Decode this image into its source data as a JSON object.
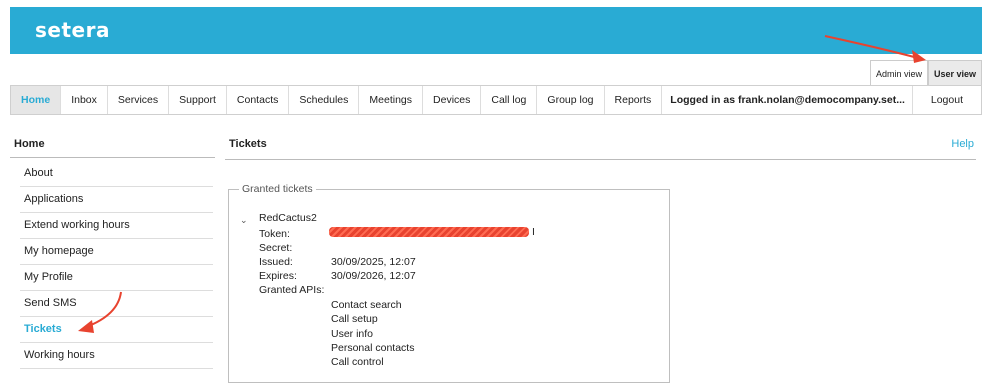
{
  "brand": {
    "logo": "setera"
  },
  "view_switch": {
    "admin": "Admin view",
    "user": "User view"
  },
  "nav": {
    "items": [
      "Home",
      "Inbox",
      "Services",
      "Support",
      "Contacts",
      "Schedules",
      "Meetings",
      "Devices",
      "Call log",
      "Group log",
      "Reports"
    ],
    "login_text": "Logged in as frank.nolan@democompany.set...",
    "logout": "Logout"
  },
  "sidebar": {
    "title": "Home",
    "items": [
      "About",
      "Applications",
      "Extend working hours",
      "My homepage",
      "My Profile",
      "Send SMS",
      "Tickets",
      "Working hours"
    ]
  },
  "main": {
    "title": "Tickets",
    "help": "Help",
    "granted_legend": "Granted tickets",
    "ticket": {
      "name": "RedCactus2",
      "token_label": "Token:",
      "token_visible_tail": "I",
      "secret_label": "Secret:",
      "issued_label": "Issued:",
      "issued_value": "30/09/2025, 12:07",
      "expires_label": "Expires:",
      "expires_value": "30/09/2026, 12:07",
      "apis_label": "Granted APIs:",
      "apis": [
        "Contact search",
        "Call setup",
        "User info",
        "Personal contacts",
        "Call control"
      ]
    }
  },
  "colors": {
    "brand": "#29abd4",
    "annotation": "#e8432f"
  }
}
